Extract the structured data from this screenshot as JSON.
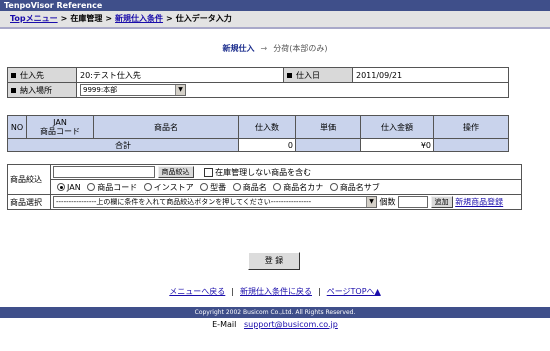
{
  "app_title": "TenpoVisor Reference",
  "breadcrumb": {
    "top_menu": "Topメニュー",
    "sep1": ">",
    "stock": "在庫管理",
    "sep2": ">",
    "new_cond": "新規仕入条件",
    "sep3": ">",
    "current": "仕入データ入力"
  },
  "steps": {
    "current": "新規仕入",
    "arrow": "→",
    "next": "分荷(本部のみ)"
  },
  "header_form": {
    "supplier_label": "仕入先",
    "supplier_value": "20:テスト仕入先",
    "date_label": "仕入日",
    "date_value": "2011/09/21",
    "place_label": "納入場所",
    "place_value": "9999:本部"
  },
  "items_table": {
    "headers": {
      "no": "NO",
      "jan": "JAN\n商品コード",
      "name": "商品名",
      "qty": "仕入数",
      "price": "単価",
      "amount": "仕入金額",
      "ops": "操作"
    },
    "total_label": "合計",
    "total_qty": "0",
    "total_amount": "¥0"
  },
  "search": {
    "narrow_label": "商品絞込",
    "narrow_value": "",
    "narrow_button": "商品絞込",
    "include_checkbox": "在庫管理しない商品を含む",
    "include_checked": false,
    "radios": [
      "JAN",
      "商品コード",
      "インストア",
      "型番",
      "商品名",
      "商品名カナ",
      "商品名サブ"
    ],
    "selected_radio": "JAN",
    "select_label": "商品選択",
    "select_value": "----------------上の欄に条件を入れて商品絞込ボタンを押してください----------------",
    "count_label": "個数",
    "count_value": "",
    "add_button": "追加",
    "new_item_link": "新規商品登録"
  },
  "submit_label": "登 録",
  "footer": {
    "menu_link": "メニューへ戻る",
    "sep1": "|",
    "back_link": "新規仕入条件に戻る",
    "sep2": "|",
    "top_link": "ページTOPへ▲",
    "copyright": "Copyright 2002 Busicom Co.,Ltd. All Rights Reserved.",
    "email_label": "E-Mail",
    "email": "support@busicom.co.jp"
  },
  "colors": {
    "titlebar": "#3f4f8a",
    "table_header": "#c9d3ec",
    "label_bg": "#d9d9d9",
    "link": "#1a0dab"
  }
}
